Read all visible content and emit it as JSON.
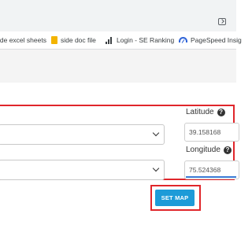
{
  "browser": {
    "bookmarks": [
      {
        "label": "ide excel sheets",
        "icon": "none"
      },
      {
        "label": "side doc file",
        "icon": "folder-icon"
      },
      {
        "label": "Login - SE Ranking",
        "icon": "signal-bars-icon"
      },
      {
        "label": "PageSpeed Insig",
        "icon": "pagespeed-icon"
      }
    ]
  },
  "form": {
    "latitude": {
      "label": "Latitude",
      "value": "39.158168"
    },
    "longitude": {
      "label": "Longitude",
      "value": "75.524368"
    },
    "set_map_label": "SET MAP"
  },
  "colors": {
    "highlight": "#e0262b",
    "button": "#1d9bd8",
    "focus_underline": "#3a7bd5"
  }
}
